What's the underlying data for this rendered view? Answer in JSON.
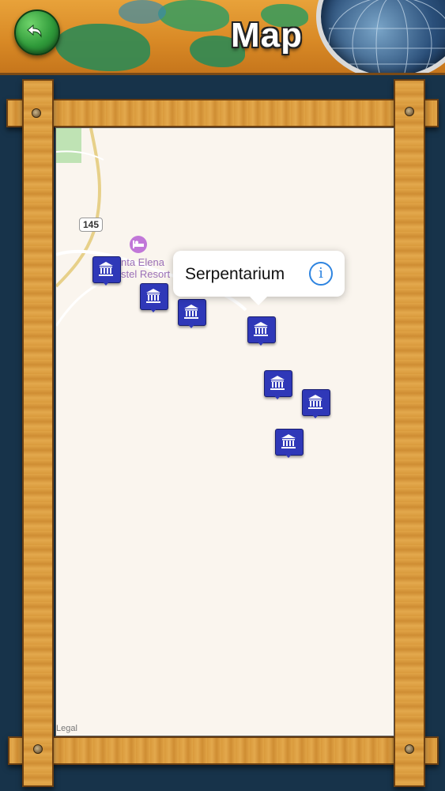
{
  "header": {
    "title": "Map",
    "back_icon": "back-arrow-icon",
    "globe_icon": "globe-icon"
  },
  "map": {
    "route_number": "145",
    "hotel_label": "nta Elena\nstel Resort",
    "hotel_icon": "bed-icon",
    "legal_label": "Legal",
    "callout_title": "Serpentarium",
    "callout_info_glyph": "i",
    "pin_icon": "museum-icon",
    "pin_color": "#2f38b8"
  }
}
